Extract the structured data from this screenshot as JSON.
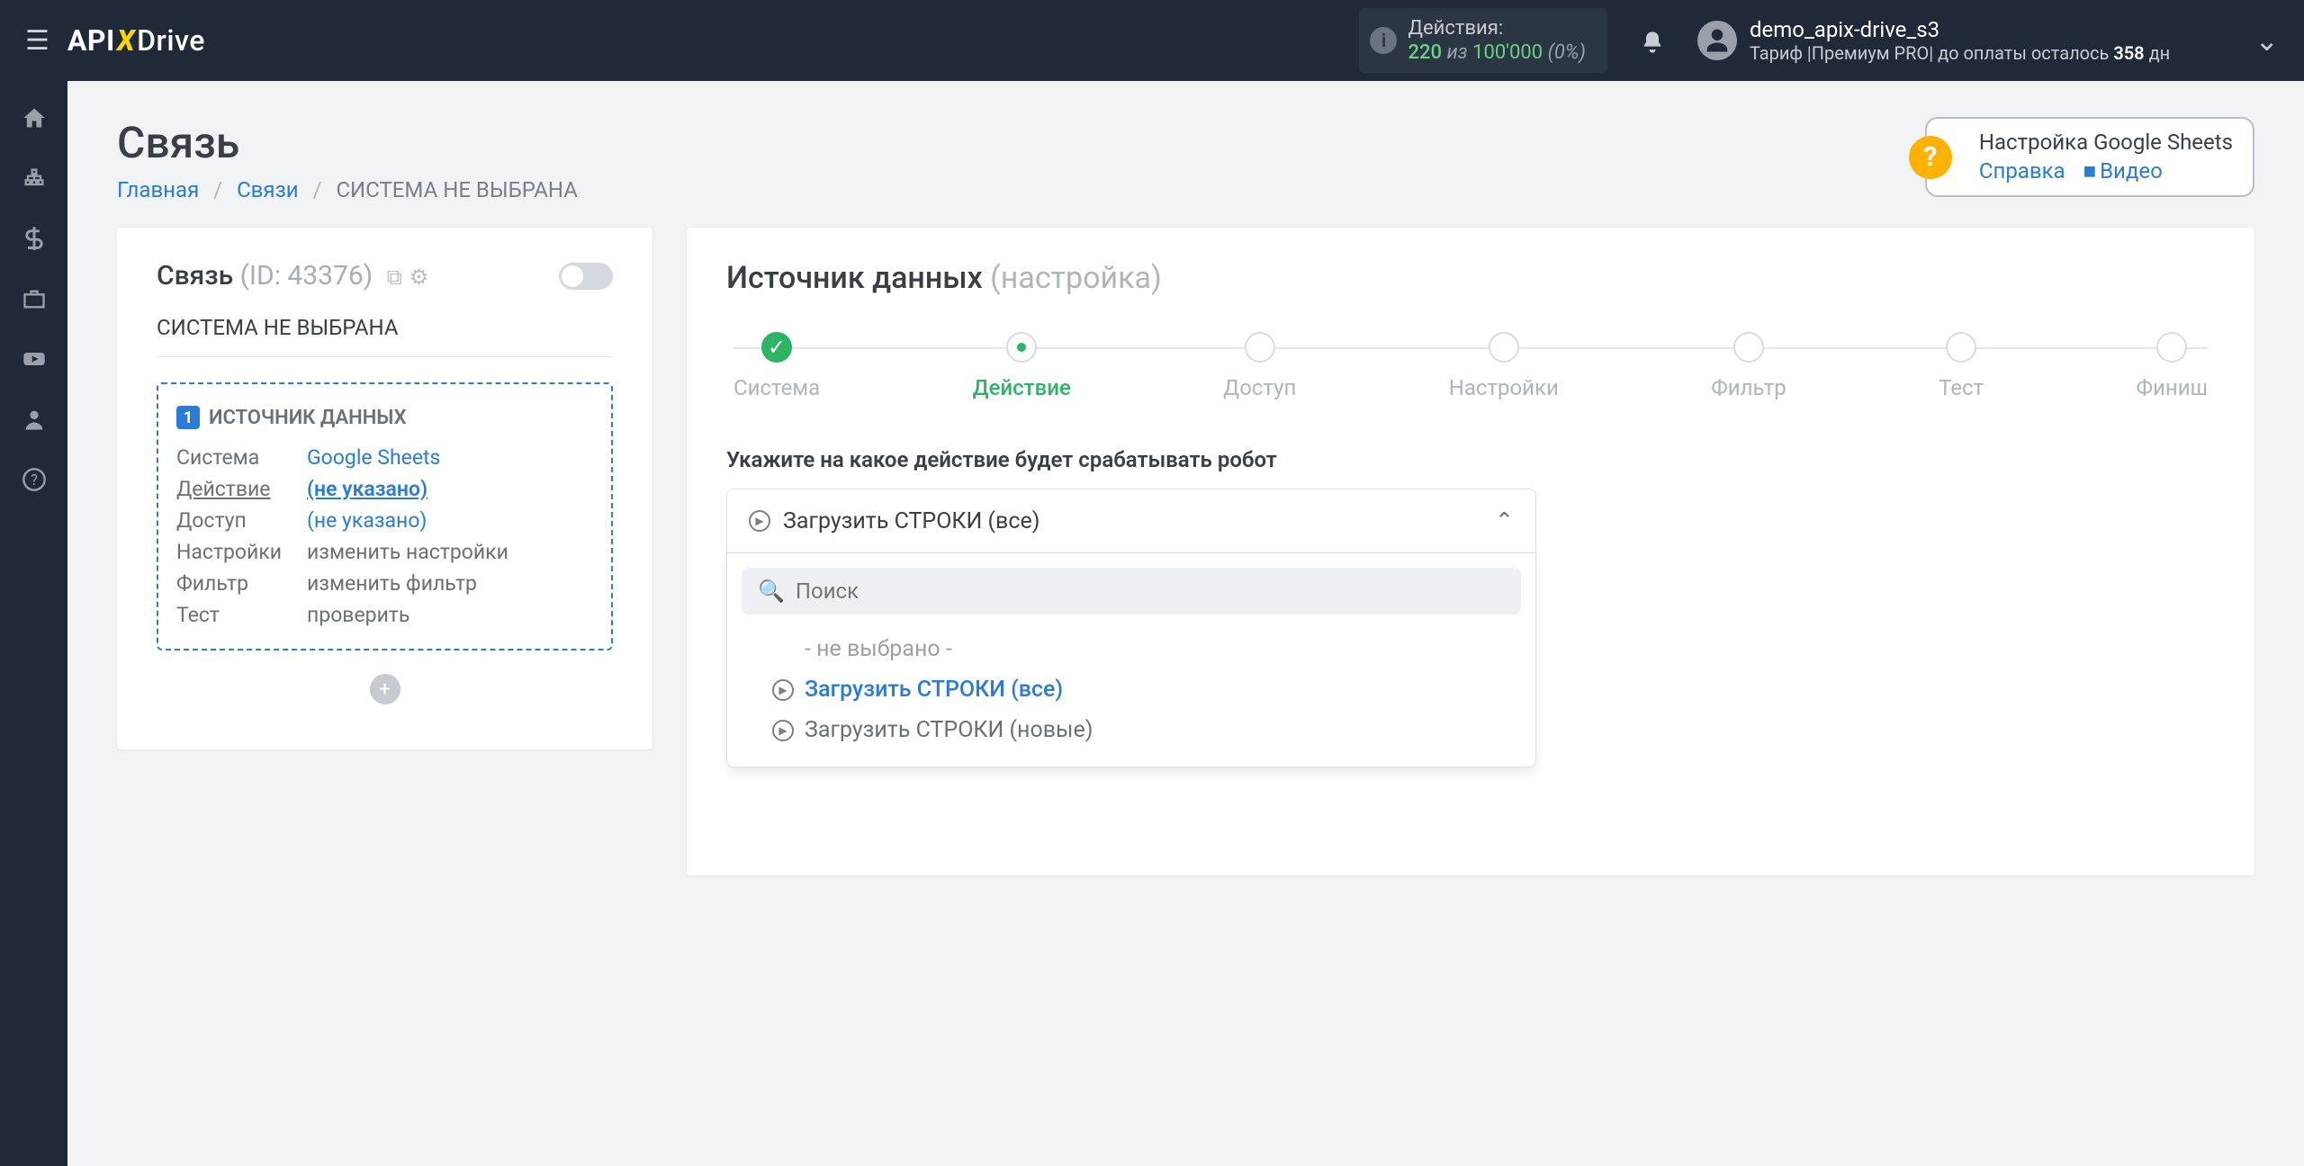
{
  "topbar": {
    "logo": {
      "part1": "API",
      "x": "X",
      "part2": "Drive"
    },
    "actions": {
      "label": "Действия:",
      "current": "220",
      "of": "из",
      "max": "100'000",
      "pct": "(0%)"
    },
    "user": {
      "name": "demo_apix-drive_s3",
      "plan_prefix": "Тариф |Премиум PRO|  до оплаты осталось ",
      "plan_days": "358",
      "plan_suffix": " дн"
    }
  },
  "page": {
    "title": "Связь",
    "crumbs": {
      "home": "Главная",
      "links": "Связи",
      "current": "СИСТЕМА НЕ ВЫБРАНА"
    }
  },
  "help": {
    "title": "Настройка Google Sheets",
    "ref": "Справка",
    "video": "Видео"
  },
  "left": {
    "title": "Связь",
    "id_label": "(ID: 43376)",
    "subtitle": "СИСТЕМА НЕ ВЫБРАНА",
    "source_title": "ИСТОЧНИК ДАННЫХ",
    "rows": {
      "system": {
        "label": "Система",
        "value": "Google Sheets"
      },
      "action": {
        "label": "Действие",
        "value": "(не указано)"
      },
      "access": {
        "label": "Доступ",
        "value": "(не указано)"
      },
      "settings": {
        "label": "Настройки",
        "value": "изменить настройки"
      },
      "filter": {
        "label": "Фильтр",
        "value": "изменить фильтр"
      },
      "test": {
        "label": "Тест",
        "value": "проверить"
      }
    }
  },
  "right": {
    "title": "Источник данных",
    "subtitle": "(настройка)",
    "steps": [
      "Система",
      "Действие",
      "Доступ",
      "Настройки",
      "Фильтр",
      "Тест",
      "Финиш"
    ],
    "field_label": "Укажите на какое действие будет срабатывать робот",
    "selected": "Загрузить СТРОКИ (все)",
    "search_placeholder": "Поиск",
    "options": {
      "none": "- не выбрано -",
      "all": "Загрузить СТРОКИ (все)",
      "new": "Загрузить СТРОКИ (новые)"
    }
  }
}
